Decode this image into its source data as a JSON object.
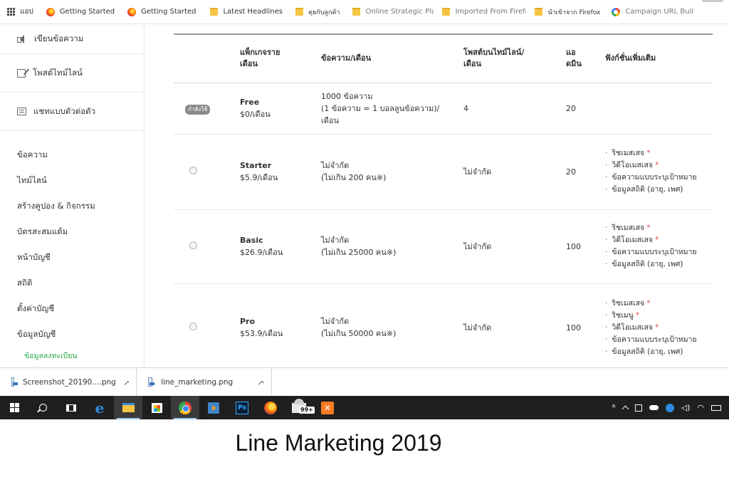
{
  "bookmarks_bar": {
    "items": [
      {
        "label": "แอป",
        "icon": "apps-grid-icon"
      },
      {
        "label": "Getting Started",
        "icon": "firefox-icon"
      },
      {
        "label": "Getting Started",
        "icon": "firefox-icon"
      },
      {
        "label": "Latest Headlines",
        "icon": "folder-icon"
      },
      {
        "label": "คุยกับลูกค้า",
        "icon": "folder-icon"
      },
      {
        "label": "Online Strategic Plan",
        "icon": "folder-icon"
      },
      {
        "label": "Imported From Firefox",
        "icon": "folder-icon"
      },
      {
        "label": "นำเข้าจาก Firefox",
        "icon": "folder-icon"
      },
      {
        "label": "Campaign URL Builder",
        "icon": "google-icon"
      }
    ]
  },
  "sidebar": {
    "actions": [
      {
        "label": "เขียนข้อความ",
        "icon": "speaker-icon"
      },
      {
        "label": "โพสต์ไทม์ไลน์",
        "icon": "edit-icon"
      },
      {
        "label": "แชทแบบตัวต่อตัว",
        "icon": "chat-icon"
      }
    ],
    "menu": [
      {
        "label": "ข้อความ"
      },
      {
        "label": "ไทม์ไลน์"
      },
      {
        "label": "สร้างคูปอง & กิจกรรม"
      },
      {
        "label": "บัตรสะสมแต้ม"
      },
      {
        "label": "หน้าบัญชี"
      },
      {
        "label": "สถิติ"
      },
      {
        "label": "ตั้งค่าบัญชี"
      },
      {
        "label": "ข้อมูลบัญชี"
      }
    ],
    "submenu_active": "ข้อมูลลงทะเบียน",
    "accent_color": "#2aa845"
  },
  "plans_table": {
    "headers": {
      "package": "แพ็กเกจราย\nเดือน",
      "messages": "ข้อความ/เดือน",
      "timeline_posts": "โพสต์บนไทม์ไลน์/\nเดือน",
      "admins": "แอ\nดมิน",
      "extra_features": "ฟังก์ชั่นเพิ่มเติม"
    },
    "current_badge": "กำลังใช้",
    "rows": [
      {
        "name": "Free",
        "price": "$0/เดือน",
        "messages_line1": "1000 ข้อความ",
        "messages_line2": "(1 ข้อความ = 1 บอลลูนข้อความ)/",
        "messages_line3": "เดือน",
        "timeline_posts": "4",
        "admins": "20",
        "features": []
      },
      {
        "name": "Starter",
        "price": "$5.9/เดือน",
        "messages_line1": "ไม่จำกัด",
        "messages_line2": "(ไม่เกิน 200 คน※)",
        "timeline_posts": "ไม่จำกัด",
        "admins": "20",
        "features": [
          {
            "text": "ริชเมสเสจ",
            "required": true
          },
          {
            "text": "วิดีโอเมสเสจ",
            "required": true
          },
          {
            "text": "ข้อความแบบระบุเป้าหมาย",
            "required": false
          },
          {
            "text": "ข้อมูลสถิติ (อายุ, เพศ)",
            "required": false
          }
        ]
      },
      {
        "name": "Basic",
        "price": "$26.9/เดือน",
        "messages_line1": "ไม่จำกัด",
        "messages_line2": "(ไม่เกิน 25000 คน※)",
        "timeline_posts": "ไม่จำกัด",
        "admins": "100",
        "features": [
          {
            "text": "ริชเมสเสจ",
            "required": true
          },
          {
            "text": "วิดีโอเมสเสจ",
            "required": true
          },
          {
            "text": "ข้อความแบบระบุเป้าหมาย",
            "required": false
          },
          {
            "text": "ข้อมูลสถิติ (อายุ, เพศ)",
            "required": false
          }
        ]
      },
      {
        "name": "Pro",
        "price": "$53.9/เดือน",
        "messages_line1": "ไม่จำกัด",
        "messages_line2": "(ไม่เกิน 50000 คน※)",
        "timeline_posts": "ไม่จำกัด",
        "admins": "100",
        "features": [
          {
            "text": "ริชเมสเสจ",
            "required": true
          },
          {
            "text": "ริชเมนู",
            "required": true
          },
          {
            "text": "วิดีโอเมสเสจ",
            "required": true
          },
          {
            "text": "ข้อความแบบระบุเป้าหมาย",
            "required": false
          },
          {
            "text": "ข้อมูลสถิติ (อายุ, เพศ)",
            "required": false
          }
        ]
      }
    ],
    "required_mark": "*",
    "required_color": "#e04848"
  },
  "download_bar": {
    "items": [
      {
        "label": "Screenshot_20190....png",
        "icon": "image-file-icon"
      },
      {
        "label": "line_marketing.png",
        "icon": "image-file-icon"
      }
    ]
  },
  "taskbar": {
    "mail_badge": "99+",
    "photoshop_label": "Ps"
  },
  "caption": "Line Marketing 2019"
}
